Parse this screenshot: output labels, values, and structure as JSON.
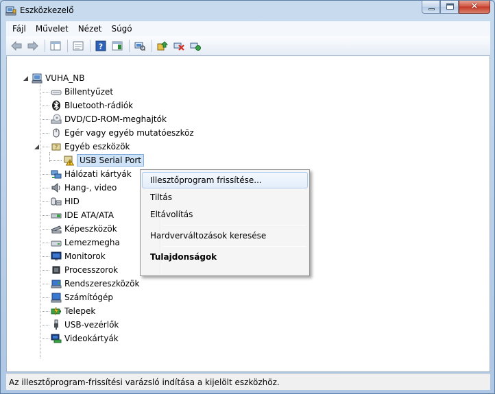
{
  "window": {
    "title": "Eszközkezelő"
  },
  "menubar": {
    "items": [
      "Fájl",
      "Művelet",
      "Nézet",
      "Súgó"
    ]
  },
  "tree": {
    "root": "VUHA_NB",
    "items": [
      "Billentyűzet",
      "Bluetooth-rádiók",
      "DVD/CD-ROM-meghajtók",
      "Egér vagy egyéb mutatóeszköz",
      "Egyéb eszközök",
      "USB Serial Port",
      "Hálózati kártyák",
      "Hang-, video",
      "HID",
      "IDE ATA/ATA",
      "Képeszközök",
      "Lemezmegha",
      "Monitorok",
      "Processzorok",
      "Rendszereszközök",
      "Számítógép",
      "Telepek",
      "USB-vezérlők",
      "Videokártyák"
    ]
  },
  "context_menu": {
    "items": [
      "Illesztőprogram frissítése...",
      "Tiltás",
      "Eltávolítás",
      "Hardverváltozások keresése",
      "Tulajdonságok"
    ]
  },
  "status": {
    "text": "Az illesztőprogram-frissítési varázsló indítása a kijelölt eszközhöz."
  },
  "colors": {
    "accent": "#84acdd",
    "selection": "#cfe3f8",
    "close_button": "#c43a28"
  }
}
